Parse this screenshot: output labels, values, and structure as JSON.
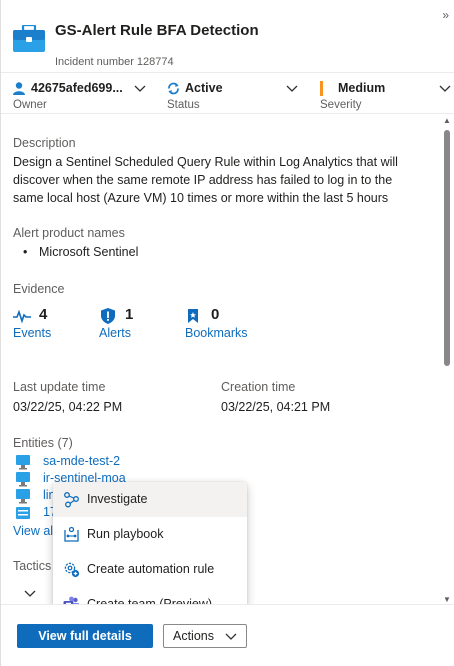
{
  "header": {
    "title": "GS-Alert Rule BFA Detection",
    "incident_number": "Incident number 128774",
    "collapse_icon": "double-chevron-right-icon"
  },
  "status_bar": {
    "owner": {
      "value": "42675afed699...",
      "label": "Owner"
    },
    "status": {
      "value": "Active",
      "label": "Status"
    },
    "severity": {
      "value": "Medium",
      "label": "Severity",
      "color": "#f7931e"
    }
  },
  "description": {
    "label": "Description",
    "text": "Design a Sentinel Scheduled Query Rule within Log Analytics that will discover when the same remote IP address has failed to log in to the same local host (Azure VM) 10 times or more within the last 5 hours"
  },
  "alert_product": {
    "label": "Alert product names",
    "items": [
      "Microsoft Sentinel"
    ]
  },
  "evidence": {
    "label": "Evidence",
    "events": {
      "count": "4",
      "label": "Events"
    },
    "alerts": {
      "count": "1",
      "label": "Alerts"
    },
    "bookmarks": {
      "count": "0",
      "label": "Bookmarks"
    }
  },
  "times": {
    "last_update_label": "Last update time",
    "last_update_value": "03/22/25, 04:22 PM",
    "creation_label": "Creation time",
    "creation_value": "03/22/25, 04:21 PM"
  },
  "entities": {
    "label": "Entities (7)",
    "items": [
      "sa-mde-test-2",
      "ir-sentinel-moa",
      "lin",
      "17"
    ],
    "view_all": "View al"
  },
  "tactics": {
    "label": "Tactics"
  },
  "menu": {
    "items": [
      {
        "label": "Investigate",
        "icon": "investigate-graph-icon"
      },
      {
        "label": "Run playbook",
        "icon": "playbook-icon"
      },
      {
        "label": "Create automation rule",
        "icon": "automation-gear-icon"
      },
      {
        "label": "Create team (Preview)",
        "icon": "teams-icon"
      }
    ]
  },
  "footer": {
    "view_full_details": "View full details",
    "actions": "Actions"
  },
  "colors": {
    "accent": "#0f6cbd",
    "severity_medium": "#f7931e"
  }
}
